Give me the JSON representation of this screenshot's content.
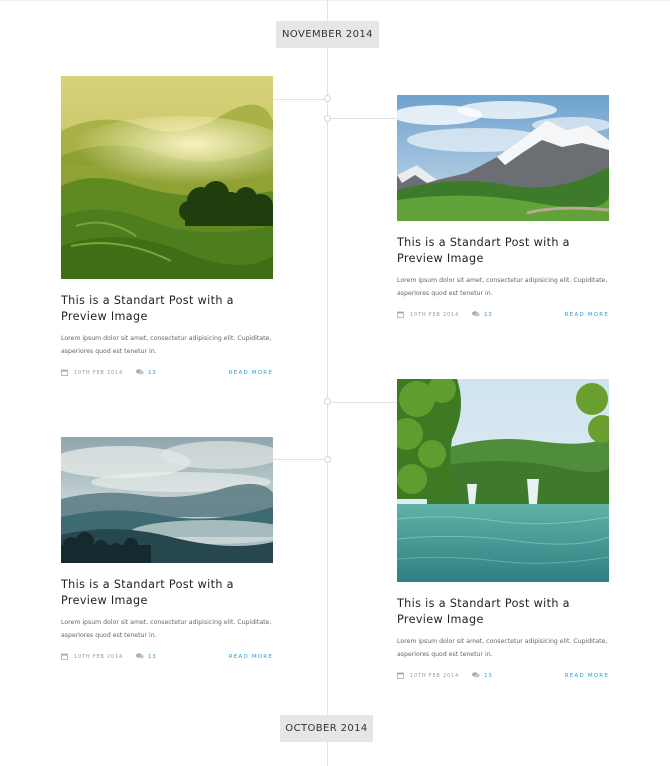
{
  "timeline": {
    "top_month": "NOVEMBER 2014",
    "bottom_month": "OCTOBER 2014"
  },
  "posts": [
    {
      "title": "This is a Standart Post with a Preview Image",
      "excerpt": "Lorem ipsum dolor sit amet, consectetur adipisicing elit. Cupiditate, asperiores quod est tenetur in.",
      "date": "10th Feb 2014",
      "comments": "13",
      "read_more": "READ MORE",
      "image": "misty-green-tea-hills"
    },
    {
      "title": "This is a Standart Post with a Preview Image",
      "excerpt": "Lorem ipsum dolor sit amet, consectetur adipisicing elit. Cupiditate, asperiores quod est tenetur in.",
      "date": "10th Feb 2014",
      "comments": "13",
      "read_more": "READ MORE",
      "image": "snowy-mountain-meadow"
    },
    {
      "title": "This is a Standart Post with a Preview Image",
      "excerpt": "Lorem ipsum dolor sit amet, consectetur adipisicing elit. Cupiditate, asperiores quod est tenetur in.",
      "date": "10th Feb 2014",
      "comments": "13",
      "read_more": "READ MORE",
      "image": "foggy-blue-mountains"
    },
    {
      "title": "This is a Standart Post with a Preview Image",
      "excerpt": "Lorem ipsum dolor sit amet, consectetur adipisicing elit. Cupiditate, asperiores quod est tenetur in.",
      "date": "10th Feb 2014",
      "comments": "13",
      "read_more": "READ MORE",
      "image": "forest-lake-waterfall"
    }
  ],
  "colors": {
    "accent": "#2a9fd6",
    "badge_bg": "#e6e6e6",
    "line": "#e3e3e3"
  }
}
